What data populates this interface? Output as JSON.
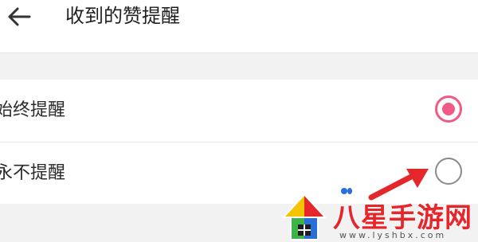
{
  "header": {
    "title": "收到的赞提醒",
    "back_icon": "arrow-left-icon"
  },
  "options": [
    {
      "label": "始终提醒",
      "selected": true
    },
    {
      "label": "永不提醒",
      "selected": false
    }
  ],
  "colors": {
    "accent": "#f05a84",
    "arrow": "#e5262b"
  },
  "watermark": {
    "title": "八星手游网",
    "url": "www.lyshbx.com"
  }
}
